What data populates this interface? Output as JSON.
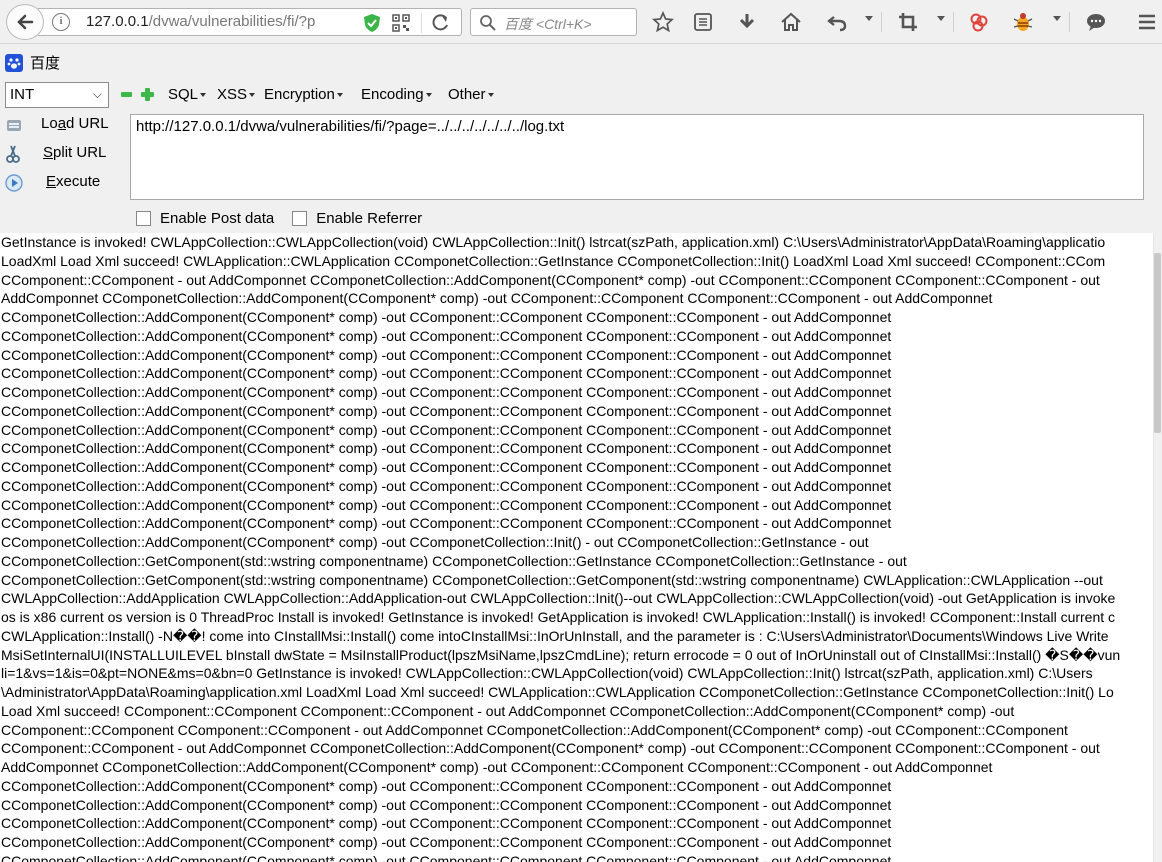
{
  "toolbar": {
    "url_host": "127.0.0.1",
    "url_path": "/dvwa/vulnerabilities/fi/?p",
    "search_placeholder": "百度 <Ctrl+K>"
  },
  "bookmarks": {
    "baidu_label": "百度"
  },
  "hackbar": {
    "select_value": "INT",
    "menus": [
      "SQL",
      "XSS",
      "Encryption",
      "Encoding",
      "Other"
    ],
    "load_url_prefix": "Lo",
    "load_url_accel": "a",
    "load_url_suffix": "d URL",
    "split_url_accel": "S",
    "split_url_suffix": "plit URL",
    "execute_accel": "E",
    "execute_suffix": "xecute",
    "url_value": "http://127.0.0.1/dvwa/vulnerabilities/fi/?page=../../../../../../../log.txt",
    "post_label": "Enable Post data",
    "referrer_label": "Enable Referrer"
  },
  "log_lines": [
    "GetInstance is invoked! CWLAppCollection::CWLAppCollection(void) CWLAppCollection::Init() lstrcat(szPath, application.xml) C:\\Users\\Administrator\\AppData\\Roaming\\applicatio",
    "LoadXml Load Xml succeed! CWLApplication::CWLApplication CComponetCollection::GetInstance CComponetCollection::Init() LoadXml Load Xml succeed! CComponent::CCom",
    "CComponent::CComponent - out AddComponnet CComponetCollection::AddComponent(CComponent* comp) -out CComponent::CComponent CComponent::CComponent - out",
    "AddComponnet CComponetCollection::AddComponent(CComponent* comp) -out CComponent::CComponent CComponent::CComponent - out AddComponnet",
    "CComponetCollection::AddComponent(CComponent* comp) -out CComponent::CComponent CComponent::CComponent - out AddComponnet",
    "CComponetCollection::AddComponent(CComponent* comp) -out CComponent::CComponent CComponent::CComponent - out AddComponnet",
    "CComponetCollection::AddComponent(CComponent* comp) -out CComponent::CComponent CComponent::CComponent - out AddComponnet",
    "CComponetCollection::AddComponent(CComponent* comp) -out CComponent::CComponent CComponent::CComponent - out AddComponnet",
    "CComponetCollection::AddComponent(CComponent* comp) -out CComponent::CComponent CComponent::CComponent - out AddComponnet",
    "CComponetCollection::AddComponent(CComponent* comp) -out CComponent::CComponent CComponent::CComponent - out AddComponnet",
    "CComponetCollection::AddComponent(CComponent* comp) -out CComponent::CComponent CComponent::CComponent - out AddComponnet",
    "CComponetCollection::AddComponent(CComponent* comp) -out CComponent::CComponent CComponent::CComponent - out AddComponnet",
    "CComponetCollection::AddComponent(CComponent* comp) -out CComponent::CComponent CComponent::CComponent - out AddComponnet",
    "CComponetCollection::AddComponent(CComponent* comp) -out CComponent::CComponent CComponent::CComponent - out AddComponnet",
    "CComponetCollection::AddComponent(CComponent* comp) -out CComponent::CComponent CComponent::CComponent - out AddComponnet",
    "CComponetCollection::AddComponent(CComponent* comp) -out CComponent::CComponent CComponent::CComponent - out AddComponnet",
    "CComponetCollection::AddComponent(CComponent* comp) -out CComponetCollection::Init() - out CComponetCollection::GetInstance - out",
    "CComponetCollection::GetComponent(std::wstring componentname) CComponetCollection::GetInstance CComponetCollection::GetInstance - out",
    "CComponetCollection::GetComponent(std::wstring componentname) CComponetCollection::GetComponent(std::wstring componentname) CWLApplication::CWLApplication --out",
    "CWLAppCollection::AddApplication CWLAppCollection::AddApplication-out CWLAppCollection::Init()--out CWLAppCollection::CWLAppCollection(void) -out GetApplication is invoke",
    "os is x86 current os version is 0 ThreadProc Install is invoked! GetInstance is invoked! GetApplication is invoked! CWLApplication::Install() is invoked! CComponent::Install current c",
    "CWLApplication::Install() -N��! come into CInstallMsi::Install() come intoCInstallMsi::InOrUnInstall, and the parameter is : C:\\Users\\Administrator\\Documents\\Windows Live Write",
    "MsiSetInternalUI(INSTALLUILEVEL bInstall dwState = MsiInstallProduct(lpszMsiName,lpszCmdLine); return errocode = 0 out of InOrUninstall out of CInstallMsi::Install() �S��vun",
    "li=1&vs=1&is=0&pt=NONE&ms=0&bn=0 GetInstance is invoked! CWLAppCollection::CWLAppCollection(void) CWLAppCollection::Init() lstrcat(szPath, application.xml) C:\\Users",
    "\\Administrator\\AppData\\Roaming\\application.xml LoadXml Load Xml succeed! CWLApplication::CWLApplication CComponetCollection::GetInstance CComponetCollection::Init() Lo",
    "Load Xml succeed! CComponent::CComponent CComponent::CComponent - out AddComponnet CComponetCollection::AddComponent(CComponent* comp) -out",
    "CComponent::CComponent CComponent::CComponent - out AddComponnet CComponetCollection::AddComponent(CComponent* comp) -out CComponent::CComponent",
    "CComponent::CComponent - out AddComponnet CComponetCollection::AddComponent(CComponent* comp) -out CComponent::CComponent CComponent::CComponent - out",
    "AddComponnet CComponetCollection::AddComponent(CComponent* comp) -out CComponent::CComponent CComponent::CComponent - out AddComponnet",
    "CComponetCollection::AddComponent(CComponent* comp) -out CComponent::CComponent CComponent::CComponent - out AddComponnet",
    "CComponetCollection::AddComponent(CComponent* comp) -out CComponent::CComponent CComponent::CComponent - out AddComponnet",
    "CComponetCollection::AddComponent(CComponent* comp) -out CComponent::CComponent CComponent::CComponent - out AddComponnet",
    "CComponetCollection::AddComponent(CComponent* comp) -out CComponent::CComponent CComponent::CComponent - out AddComponnet",
    "CComponetCollection::AddComponent(CComponent* comp) -out CComponent::CComponent CComponent::CComponent - out AddComponnet"
  ]
}
